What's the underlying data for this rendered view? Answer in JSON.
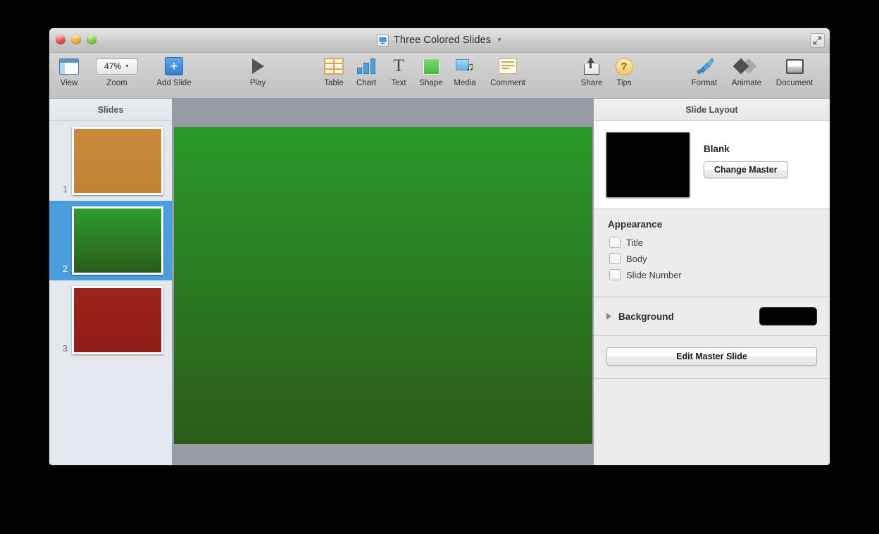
{
  "window": {
    "title": "Three Colored Slides",
    "title_chevron": "▼",
    "doc_icon": "keynote-document-icon",
    "traffic_lights": [
      "close",
      "minimize",
      "zoom"
    ],
    "fullscreen_icon": "fullscreen-diagonal-arrows-icon"
  },
  "toolbar": {
    "items": [
      {
        "label": "View",
        "icon": "view-layout-icon"
      },
      {
        "label": "Zoom",
        "icon": "zoom-popup-icon",
        "value": "47%",
        "arrow": "▼"
      },
      {
        "label": "Add Slide",
        "icon": "add-slide-plus-icon"
      },
      {
        "label": "Play",
        "icon": "play-triangle-icon"
      },
      {
        "label": "Table",
        "icon": "table-grid-icon"
      },
      {
        "label": "Chart",
        "icon": "bar-chart-icon"
      },
      {
        "label": "Text",
        "icon": "text-t-icon"
      },
      {
        "label": "Shape",
        "icon": "green-square-shape-icon"
      },
      {
        "label": "Media",
        "icon": "media-photo-note-icon"
      },
      {
        "label": "Comment",
        "icon": "comment-note-icon"
      },
      {
        "label": "Share",
        "icon": "share-upload-icon"
      },
      {
        "label": "Tips",
        "icon": "question-mark-circle-icon"
      },
      {
        "label": "Format",
        "icon": "paintbrush-format-icon"
      },
      {
        "label": "Animate",
        "icon": "two-diamonds-animate-icon"
      },
      {
        "label": "Document",
        "icon": "document-page-icon"
      }
    ]
  },
  "navigator": {
    "header": "Slides",
    "slides": [
      {
        "number": "1",
        "color_top": "#ca8a3d",
        "color_bottom": "#c28233",
        "selected": false
      },
      {
        "number": "2",
        "color_top": "#2f9c2c",
        "color_bottom": "#2a5c19",
        "selected": true
      },
      {
        "number": "3",
        "color_top": "#9c231b",
        "color_bottom": "#8e1d16",
        "selected": false
      }
    ],
    "selection_color": "#4a9ede"
  },
  "canvas": {
    "backdrop_color": "#979ba3",
    "slide_color_top": "#2a9a2a",
    "slide_color_bottom": "#2b5a18"
  },
  "inspector": {
    "header": "Slide Layout",
    "master": {
      "name": "Blank",
      "thumb_color": "#000000",
      "change_master_label": "Change Master"
    },
    "appearance": {
      "title": "Appearance",
      "options": [
        {
          "label": "Title",
          "checked": false
        },
        {
          "label": "Body",
          "checked": false
        },
        {
          "label": "Slide Number",
          "checked": false
        }
      ]
    },
    "background": {
      "label": "Background",
      "disclosure": "collapsed",
      "color": "#000000"
    },
    "edit_master_label": "Edit Master Slide"
  }
}
